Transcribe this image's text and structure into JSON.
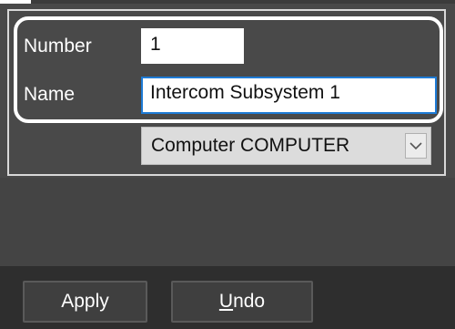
{
  "form": {
    "number_label": "Number",
    "number_value": "1",
    "name_label": "Name",
    "name_value": "Intercom Subsystem 1",
    "computer_value": "Computer COMPUTER"
  },
  "buttons": {
    "apply_label": "Apply",
    "undo_first": "U",
    "undo_rest": "ndo"
  },
  "icons": {
    "dropdown": "chevron-down-icon"
  },
  "colors": {
    "background": "#494949",
    "bottom_bar": "#2e2e2e",
    "focus_border": "#1e7bd6",
    "highlight": "#ffffff"
  }
}
